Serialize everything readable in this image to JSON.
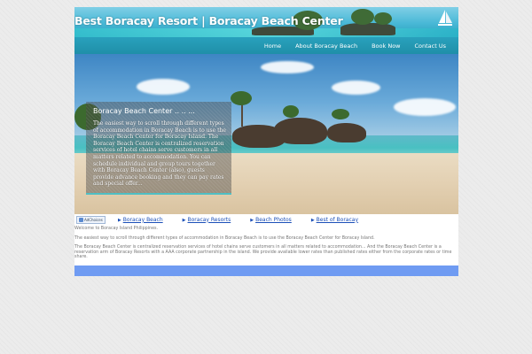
{
  "header": {
    "site_title": "Best Boracay Resort | Boracay Beach Center",
    "nav": [
      {
        "label": "Home"
      },
      {
        "label": "About Boracay Beach"
      },
      {
        "label": "Book Now"
      },
      {
        "label": "Contact Us"
      }
    ]
  },
  "hero": {
    "caption_title": "Boracay Beach Center .. .. ...",
    "caption_text": "The easiest way to scroll through different types of accommodation in Boracay Beach is to use the Boracay Beach Center for Boracay Island. The Boracay Beach Center is centralized reservation services of hotel chains serve customers in all matters related to accommodation. You can schedule individual and group tours together with Boracay Beach Center (also), guests provide advance booking and they can pay rates and special offer..."
  },
  "ad_row": {
    "adchoices_label": "AdChoices",
    "links": [
      {
        "label": "Boracay Beach"
      },
      {
        "label": "Boracay Resorts"
      },
      {
        "label": "Beach Photos"
      },
      {
        "label": "Best of Boracay"
      }
    ]
  },
  "content": {
    "welcome": "Welcome to Boracay Island Philippines.",
    "para1": "The easiest way to scroll through different types of accommodation in Boracay Beach is to use the Boracay Beach Center for Boracay Island.",
    "para2": "The Boracay Beach Center is centralized reservation services of hotel chains serve customers in all matters related to accommodation... And the Boracay Beach Center is a reservation arm of Boracay Resorts with a AAA corporate partnership in the island. We provide available lower rates than published rates either from the corporate rates or time share."
  },
  "colors": {
    "link_blue": "#1b4fb8",
    "footer_bar": "#6f9bf2",
    "caption_accent": "#4fbfc4"
  }
}
